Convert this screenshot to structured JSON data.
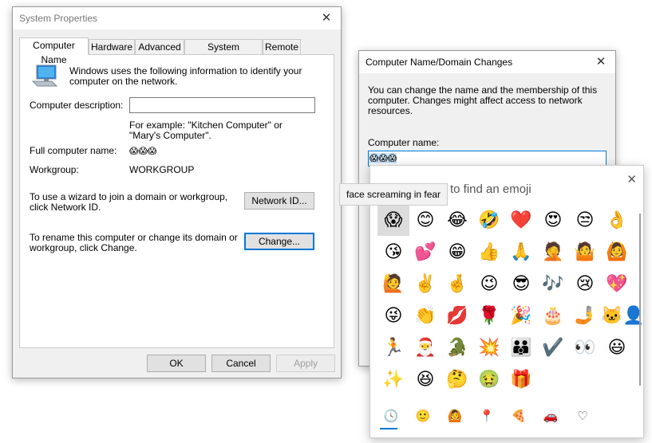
{
  "system_properties": {
    "title": "System Properties",
    "close": "✕",
    "tabs": [
      "Computer Name",
      "Hardware",
      "Advanced",
      "System Protection",
      "Remote"
    ],
    "intro": "Windows uses the following information to identify your computer on the network.",
    "description_label": "Computer description:",
    "description_value": "",
    "example_text": "For example: \"Kitchen Computer\" or \"Mary's Computer\".",
    "full_name_label": "Full computer name:",
    "full_name_value": "😱😱😱",
    "workgroup_label": "Workgroup:",
    "workgroup_value": "WORKGROUP",
    "wizard_text": "To use a wizard to join a domain or workgroup, click Network ID.",
    "network_id_button": "Network ID...",
    "rename_text": "To rename this computer or change its domain or workgroup, click Change.",
    "change_button": "Change...",
    "ok_button": "OK",
    "cancel_button": "Cancel",
    "apply_button": "Apply"
  },
  "domain_changes": {
    "title": "Computer Name/Domain Changes",
    "close": "✕",
    "intro": "You can change the name and the membership of this computer. Changes might affect access to network resources.",
    "computer_name_label": "Computer name:",
    "computer_name_value": "😱😱😱"
  },
  "emoji_panel": {
    "hint": "to find an emoji",
    "close": "✕",
    "tooltip": "face screaming in fear",
    "emojis": [
      "😱",
      "😊",
      "😂",
      "🤣",
      "❤️",
      "😍",
      "😒",
      "👌",
      "😘",
      "💕",
      "😁",
      "👍",
      "🙏",
      "🤦",
      "🤷",
      "🙆",
      "🙋",
      "✌️",
      "🤞",
      "😉",
      "😎",
      "🎶",
      "😢",
      "💖",
      "😜",
      "👏",
      "💋",
      "🌹",
      "🎉",
      "🎂",
      "🤳",
      "🐱‍👤",
      "🏃",
      "🎅",
      "🐊",
      "💥",
      "👪",
      "✔️",
      "👀",
      "😃",
      "✨",
      "😆",
      "🤔",
      "🤢",
      "🎁"
    ],
    "categories": [
      "🕓",
      "🙂",
      "🙆",
      "📍",
      "🍕",
      "🚗",
      "♡"
    ]
  }
}
